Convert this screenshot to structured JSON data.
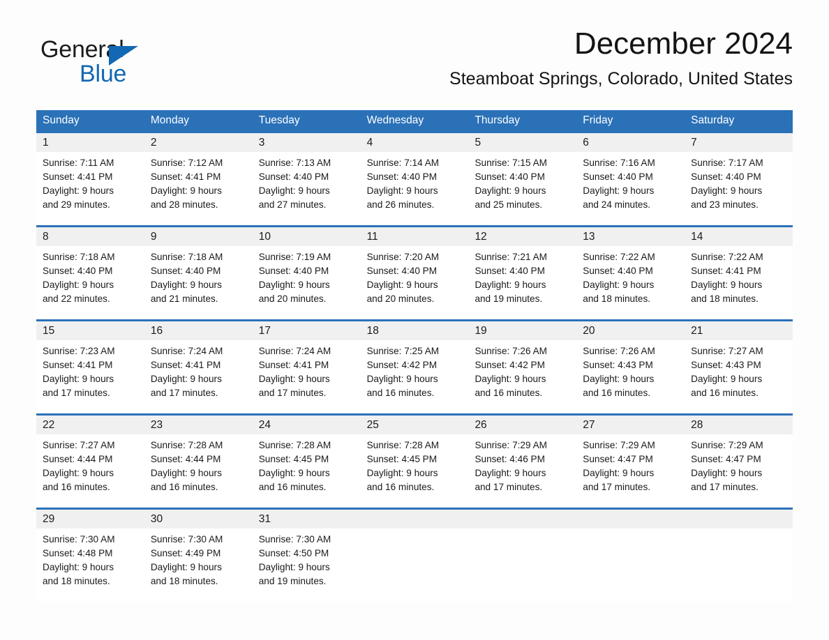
{
  "brand": {
    "name_part1": "General",
    "name_part2": "Blue",
    "logo_icon": "triangle-flag-icon",
    "accent_color": "#1268b3"
  },
  "header": {
    "month_title": "December 2024",
    "location": "Steamboat Springs, Colorado, United States"
  },
  "theme": {
    "header_bar_color": "#2a71b8",
    "date_band_color": "#f0f0f0",
    "page_background": "#fdfdfd"
  },
  "calendar": {
    "weekdays": [
      "Sunday",
      "Monday",
      "Tuesday",
      "Wednesday",
      "Thursday",
      "Friday",
      "Saturday"
    ],
    "weeks": [
      {
        "dates": [
          "1",
          "2",
          "3",
          "4",
          "5",
          "6",
          "7"
        ],
        "cells": [
          {
            "sunrise": "Sunrise: 7:11 AM",
            "sunset": "Sunset: 4:41 PM",
            "daylight_1": "Daylight: 9 hours",
            "daylight_2": "and 29 minutes."
          },
          {
            "sunrise": "Sunrise: 7:12 AM",
            "sunset": "Sunset: 4:41 PM",
            "daylight_1": "Daylight: 9 hours",
            "daylight_2": "and 28 minutes."
          },
          {
            "sunrise": "Sunrise: 7:13 AM",
            "sunset": "Sunset: 4:40 PM",
            "daylight_1": "Daylight: 9 hours",
            "daylight_2": "and 27 minutes."
          },
          {
            "sunrise": "Sunrise: 7:14 AM",
            "sunset": "Sunset: 4:40 PM",
            "daylight_1": "Daylight: 9 hours",
            "daylight_2": "and 26 minutes."
          },
          {
            "sunrise": "Sunrise: 7:15 AM",
            "sunset": "Sunset: 4:40 PM",
            "daylight_1": "Daylight: 9 hours",
            "daylight_2": "and 25 minutes."
          },
          {
            "sunrise": "Sunrise: 7:16 AM",
            "sunset": "Sunset: 4:40 PM",
            "daylight_1": "Daylight: 9 hours",
            "daylight_2": "and 24 minutes."
          },
          {
            "sunrise": "Sunrise: 7:17 AM",
            "sunset": "Sunset: 4:40 PM",
            "daylight_1": "Daylight: 9 hours",
            "daylight_2": "and 23 minutes."
          }
        ]
      },
      {
        "dates": [
          "8",
          "9",
          "10",
          "11",
          "12",
          "13",
          "14"
        ],
        "cells": [
          {
            "sunrise": "Sunrise: 7:18 AM",
            "sunset": "Sunset: 4:40 PM",
            "daylight_1": "Daylight: 9 hours",
            "daylight_2": "and 22 minutes."
          },
          {
            "sunrise": "Sunrise: 7:18 AM",
            "sunset": "Sunset: 4:40 PM",
            "daylight_1": "Daylight: 9 hours",
            "daylight_2": "and 21 minutes."
          },
          {
            "sunrise": "Sunrise: 7:19 AM",
            "sunset": "Sunset: 4:40 PM",
            "daylight_1": "Daylight: 9 hours",
            "daylight_2": "and 20 minutes."
          },
          {
            "sunrise": "Sunrise: 7:20 AM",
            "sunset": "Sunset: 4:40 PM",
            "daylight_1": "Daylight: 9 hours",
            "daylight_2": "and 20 minutes."
          },
          {
            "sunrise": "Sunrise: 7:21 AM",
            "sunset": "Sunset: 4:40 PM",
            "daylight_1": "Daylight: 9 hours",
            "daylight_2": "and 19 minutes."
          },
          {
            "sunrise": "Sunrise: 7:22 AM",
            "sunset": "Sunset: 4:40 PM",
            "daylight_1": "Daylight: 9 hours",
            "daylight_2": "and 18 minutes."
          },
          {
            "sunrise": "Sunrise: 7:22 AM",
            "sunset": "Sunset: 4:41 PM",
            "daylight_1": "Daylight: 9 hours",
            "daylight_2": "and 18 minutes."
          }
        ]
      },
      {
        "dates": [
          "15",
          "16",
          "17",
          "18",
          "19",
          "20",
          "21"
        ],
        "cells": [
          {
            "sunrise": "Sunrise: 7:23 AM",
            "sunset": "Sunset: 4:41 PM",
            "daylight_1": "Daylight: 9 hours",
            "daylight_2": "and 17 minutes."
          },
          {
            "sunrise": "Sunrise: 7:24 AM",
            "sunset": "Sunset: 4:41 PM",
            "daylight_1": "Daylight: 9 hours",
            "daylight_2": "and 17 minutes."
          },
          {
            "sunrise": "Sunrise: 7:24 AM",
            "sunset": "Sunset: 4:41 PM",
            "daylight_1": "Daylight: 9 hours",
            "daylight_2": "and 17 minutes."
          },
          {
            "sunrise": "Sunrise: 7:25 AM",
            "sunset": "Sunset: 4:42 PM",
            "daylight_1": "Daylight: 9 hours",
            "daylight_2": "and 16 minutes."
          },
          {
            "sunrise": "Sunrise: 7:26 AM",
            "sunset": "Sunset: 4:42 PM",
            "daylight_1": "Daylight: 9 hours",
            "daylight_2": "and 16 minutes."
          },
          {
            "sunrise": "Sunrise: 7:26 AM",
            "sunset": "Sunset: 4:43 PM",
            "daylight_1": "Daylight: 9 hours",
            "daylight_2": "and 16 minutes."
          },
          {
            "sunrise": "Sunrise: 7:27 AM",
            "sunset": "Sunset: 4:43 PM",
            "daylight_1": "Daylight: 9 hours",
            "daylight_2": "and 16 minutes."
          }
        ]
      },
      {
        "dates": [
          "22",
          "23",
          "24",
          "25",
          "26",
          "27",
          "28"
        ],
        "cells": [
          {
            "sunrise": "Sunrise: 7:27 AM",
            "sunset": "Sunset: 4:44 PM",
            "daylight_1": "Daylight: 9 hours",
            "daylight_2": "and 16 minutes."
          },
          {
            "sunrise": "Sunrise: 7:28 AM",
            "sunset": "Sunset: 4:44 PM",
            "daylight_1": "Daylight: 9 hours",
            "daylight_2": "and 16 minutes."
          },
          {
            "sunrise": "Sunrise: 7:28 AM",
            "sunset": "Sunset: 4:45 PM",
            "daylight_1": "Daylight: 9 hours",
            "daylight_2": "and 16 minutes."
          },
          {
            "sunrise": "Sunrise: 7:28 AM",
            "sunset": "Sunset: 4:45 PM",
            "daylight_1": "Daylight: 9 hours",
            "daylight_2": "and 16 minutes."
          },
          {
            "sunrise": "Sunrise: 7:29 AM",
            "sunset": "Sunset: 4:46 PM",
            "daylight_1": "Daylight: 9 hours",
            "daylight_2": "and 17 minutes."
          },
          {
            "sunrise": "Sunrise: 7:29 AM",
            "sunset": "Sunset: 4:47 PM",
            "daylight_1": "Daylight: 9 hours",
            "daylight_2": "and 17 minutes."
          },
          {
            "sunrise": "Sunrise: 7:29 AM",
            "sunset": "Sunset: 4:47 PM",
            "daylight_1": "Daylight: 9 hours",
            "daylight_2": "and 17 minutes."
          }
        ]
      },
      {
        "dates": [
          "29",
          "30",
          "31",
          "",
          "",
          "",
          ""
        ],
        "cells": [
          {
            "sunrise": "Sunrise: 7:30 AM",
            "sunset": "Sunset: 4:48 PM",
            "daylight_1": "Daylight: 9 hours",
            "daylight_2": "and 18 minutes."
          },
          {
            "sunrise": "Sunrise: 7:30 AM",
            "sunset": "Sunset: 4:49 PM",
            "daylight_1": "Daylight: 9 hours",
            "daylight_2": "and 18 minutes."
          },
          {
            "sunrise": "Sunrise: 7:30 AM",
            "sunset": "Sunset: 4:50 PM",
            "daylight_1": "Daylight: 9 hours",
            "daylight_2": "and 19 minutes."
          },
          {
            "sunrise": "",
            "sunset": "",
            "daylight_1": "",
            "daylight_2": ""
          },
          {
            "sunrise": "",
            "sunset": "",
            "daylight_1": "",
            "daylight_2": ""
          },
          {
            "sunrise": "",
            "sunset": "",
            "daylight_1": "",
            "daylight_2": ""
          },
          {
            "sunrise": "",
            "sunset": "",
            "daylight_1": "",
            "daylight_2": ""
          }
        ]
      }
    ]
  }
}
